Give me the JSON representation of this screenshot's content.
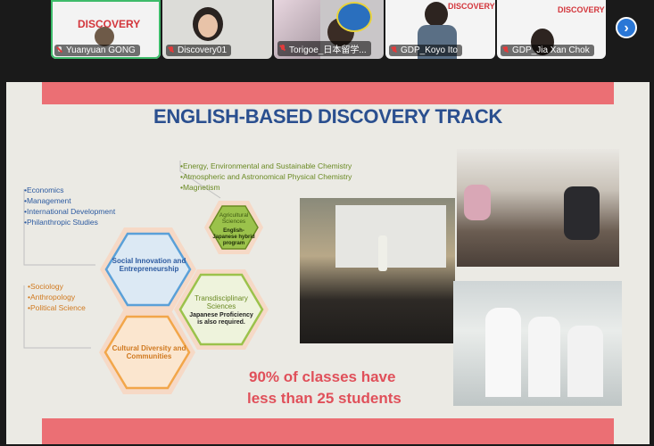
{
  "participants": [
    {
      "name": "Yuanyuan GONG",
      "active": true,
      "muted": false,
      "logo": "DISCOVERY"
    },
    {
      "name": "Discovery01",
      "active": false,
      "muted": true
    },
    {
      "name": "Torigoe_日本留学...",
      "active": false,
      "muted": true
    },
    {
      "name": "GDP_Koyo Ito",
      "active": false,
      "muted": true,
      "logo": "DISCOVERY"
    },
    {
      "name": "GDP_Jia Xan Chok",
      "active": false,
      "muted": true,
      "logo": "DISCOVERY"
    }
  ],
  "next_button": "›",
  "slide": {
    "title": "ENGLISH-BASED DISCOVERY TRACK",
    "fields_blue": [
      "•Economics",
      "•Management",
      "•International Development",
      "•Philanthropic Studies"
    ],
    "fields_green": [
      "•Energy, Environmental and Sustainable Chemistry",
      "•Atmospheric and Astronomical Physical Chemistry",
      "•Magnetism"
    ],
    "fields_orange": [
      "•Sociology",
      "•Anthropology",
      "•Political Science"
    ],
    "hex_social": "Social Innovation and Entrepreneurship",
    "hex_agri_title": "Agricultural Sciences",
    "hex_agri_sub": "English-Japanese hybrid program",
    "hex_trans_title": "Transdisciplinary Sciences",
    "hex_trans_sub": "Japanese Proficiency is also required.",
    "hex_cultural": "Cultural Diversity and Communities",
    "stat_pct": "90%",
    "stat_line1": " of classes have",
    "stat_line2": "less than 25 students"
  },
  "colors": {
    "accent_red": "#eb6f74",
    "title_blue": "#2a4f8f",
    "hex_blue": "#5aa0d8",
    "hex_green": "#9bc24b",
    "hex_orange": "#f2a64a"
  }
}
